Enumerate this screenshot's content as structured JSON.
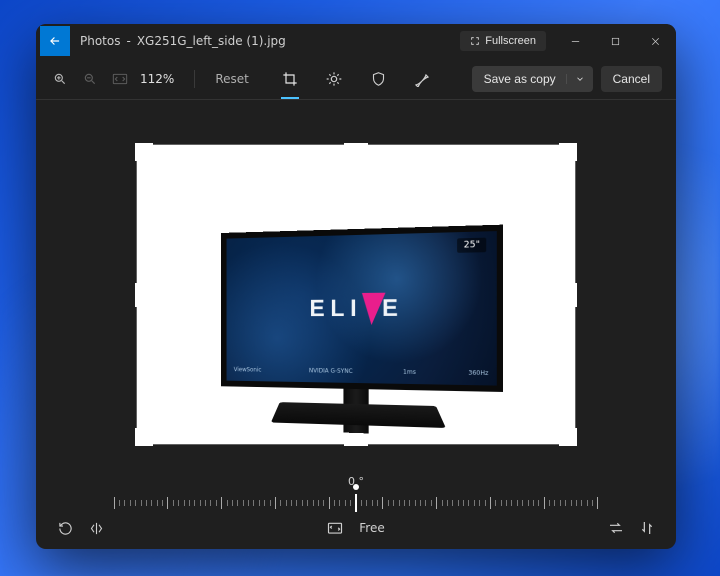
{
  "titlebar": {
    "app": "Photos",
    "filename": "XG251G_left_side (1).jpg",
    "fullscreen_label": "Fullscreen"
  },
  "toolbar": {
    "zoom_percent": "112%",
    "reset_label": "Reset",
    "save_label": "Save as copy",
    "cancel_label": "Cancel"
  },
  "image_content": {
    "brand_text": "ELITE",
    "size_badge": "25\"",
    "bezel_left": "ViewSonic",
    "bezel_mid": "NVIDIA G-SYNC",
    "bezel_mid2": "1ms",
    "bezel_right": "360Hz"
  },
  "rotation": {
    "angle_label": "0 °"
  },
  "bottombar": {
    "aspect_label": "Free"
  }
}
